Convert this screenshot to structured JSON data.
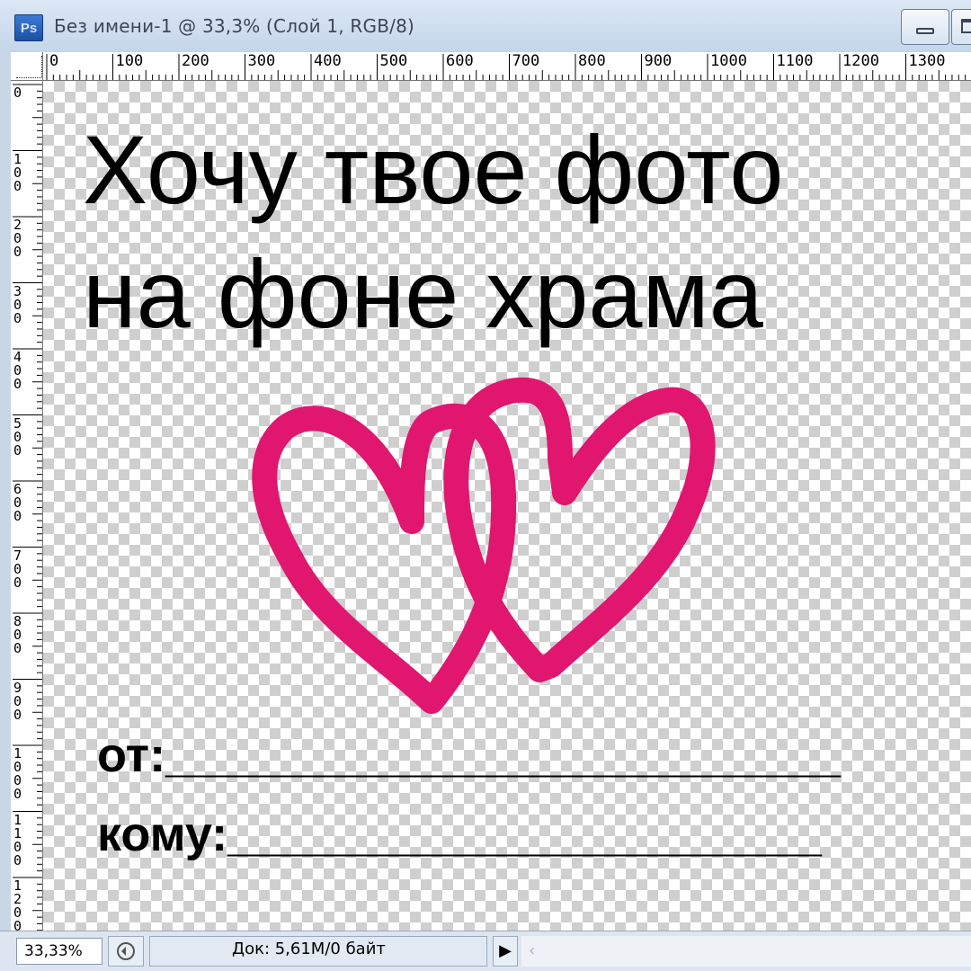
{
  "window": {
    "app_icon_label": "Ps",
    "title": "Без имени-1 @ 33,3% (Слой 1, RGB/8)"
  },
  "rulers": {
    "horizontal": [
      "0",
      "100",
      "200",
      "300",
      "400",
      "500",
      "600",
      "700",
      "800",
      "900",
      "1000",
      "1100",
      "1200",
      "1300"
    ],
    "vertical": [
      "0",
      "100",
      "200",
      "300",
      "400",
      "500",
      "600",
      "700",
      "800",
      "900",
      "1000",
      "1100",
      "1200"
    ]
  },
  "canvas": {
    "headline_line1": "Хочу твое фото",
    "headline_line2": "на фоне храма",
    "from_field": "от:_________________________",
    "to_field": "кому:______________________",
    "heart_color": "#e0166f",
    "artwork_icon": "double-heart-icon"
  },
  "statusbar": {
    "zoom": "33,33%",
    "doc_info": "Док: 5,61M/0 байт",
    "play_icon": "▶",
    "scroll_left_icon": "‹"
  }
}
